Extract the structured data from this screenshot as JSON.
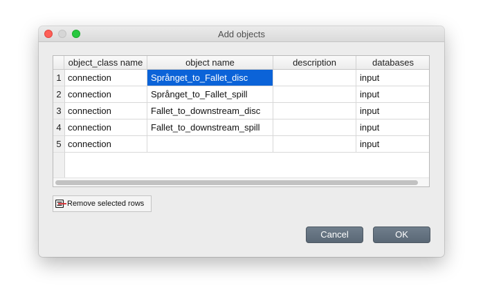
{
  "window": {
    "title": "Add objects"
  },
  "table": {
    "columns": [
      "object_class name",
      "object name",
      "description",
      "databases"
    ],
    "rows": [
      {
        "num": "1",
        "object_class_name": "connection",
        "object_name": "Språnget_to_Fallet_disc",
        "description": "",
        "databases": "input"
      },
      {
        "num": "2",
        "object_class_name": "connection",
        "object_name": "Språnget_to_Fallet_spill",
        "description": "",
        "databases": "input"
      },
      {
        "num": "3",
        "object_class_name": "connection",
        "object_name": "Fallet_to_downstream_disc",
        "description": "",
        "databases": "input"
      },
      {
        "num": "4",
        "object_class_name": "connection",
        "object_name": "Fallet_to_downstream_spill",
        "description": "",
        "databases": "input"
      },
      {
        "num": "5",
        "object_class_name": "connection",
        "object_name": "",
        "description": "",
        "databases": "input"
      }
    ],
    "selected_cell": "row 1, object name"
  },
  "buttons": {
    "remove_selected_rows": "Remove selected rows",
    "cancel": "Cancel",
    "ok": "OK"
  },
  "icons": {
    "remove": "remove-rows-icon"
  },
  "colors": {
    "selection": "#0b63d8",
    "button_bg": "#5f6d7a",
    "close": "#fe5f57",
    "maximize": "#28c840"
  }
}
